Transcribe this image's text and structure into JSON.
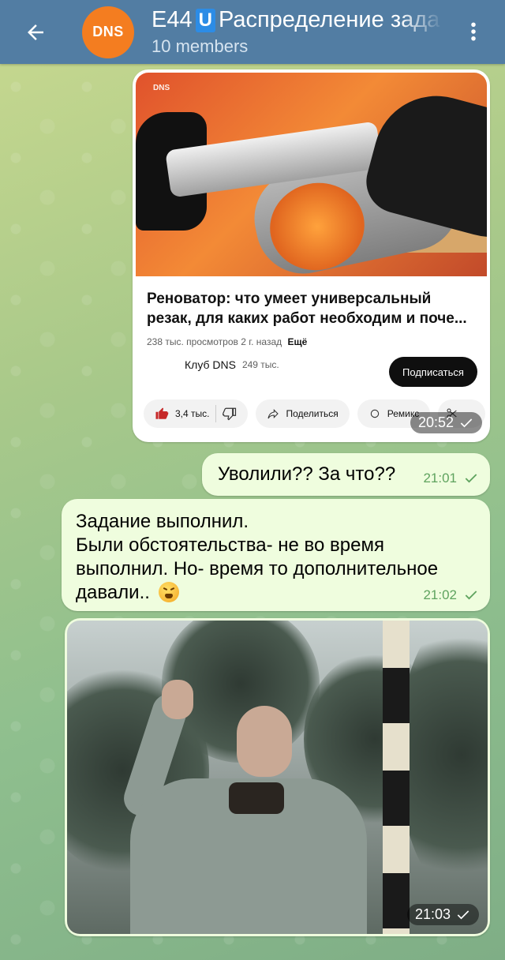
{
  "header": {
    "avatar_text": "DNS",
    "title_prefix": "E44",
    "title_badge": "U",
    "title_rest": "Распределение зада",
    "subtitle": "10 members"
  },
  "messages": {
    "youtube": {
      "thumb_logo": "DNS",
      "title": "Реноватор: что умеет универсальный резак, для каких работ необходим и поче...",
      "views": "238 тыс. просмотров",
      "age": "2 г. назад",
      "more": "Ещё",
      "channel": "Клуб DNS",
      "subscribers": "249 тыс.",
      "subscribe": "Подписаться",
      "likes": "3,4 тыс.",
      "share": "Поделиться",
      "remix": "Ремикс",
      "time": "20:52"
    },
    "uvolili": {
      "text": "Уволили?? За что??",
      "time": "21:01"
    },
    "zadanie": {
      "text_line1": "Задание выполнил.",
      "text_line2": "Были обстоятельства- не во время",
      "text_line3": "выполнил. Но- время то дополнительное",
      "text_line4": "давали..",
      "time": "21:02"
    },
    "photo": {
      "time": "21:03"
    }
  },
  "colors": {
    "header_bg": "#527da3",
    "bubble_bg": "#effdde",
    "meta_green": "#5fa35f",
    "avatar_orange": "#f47d20"
  }
}
